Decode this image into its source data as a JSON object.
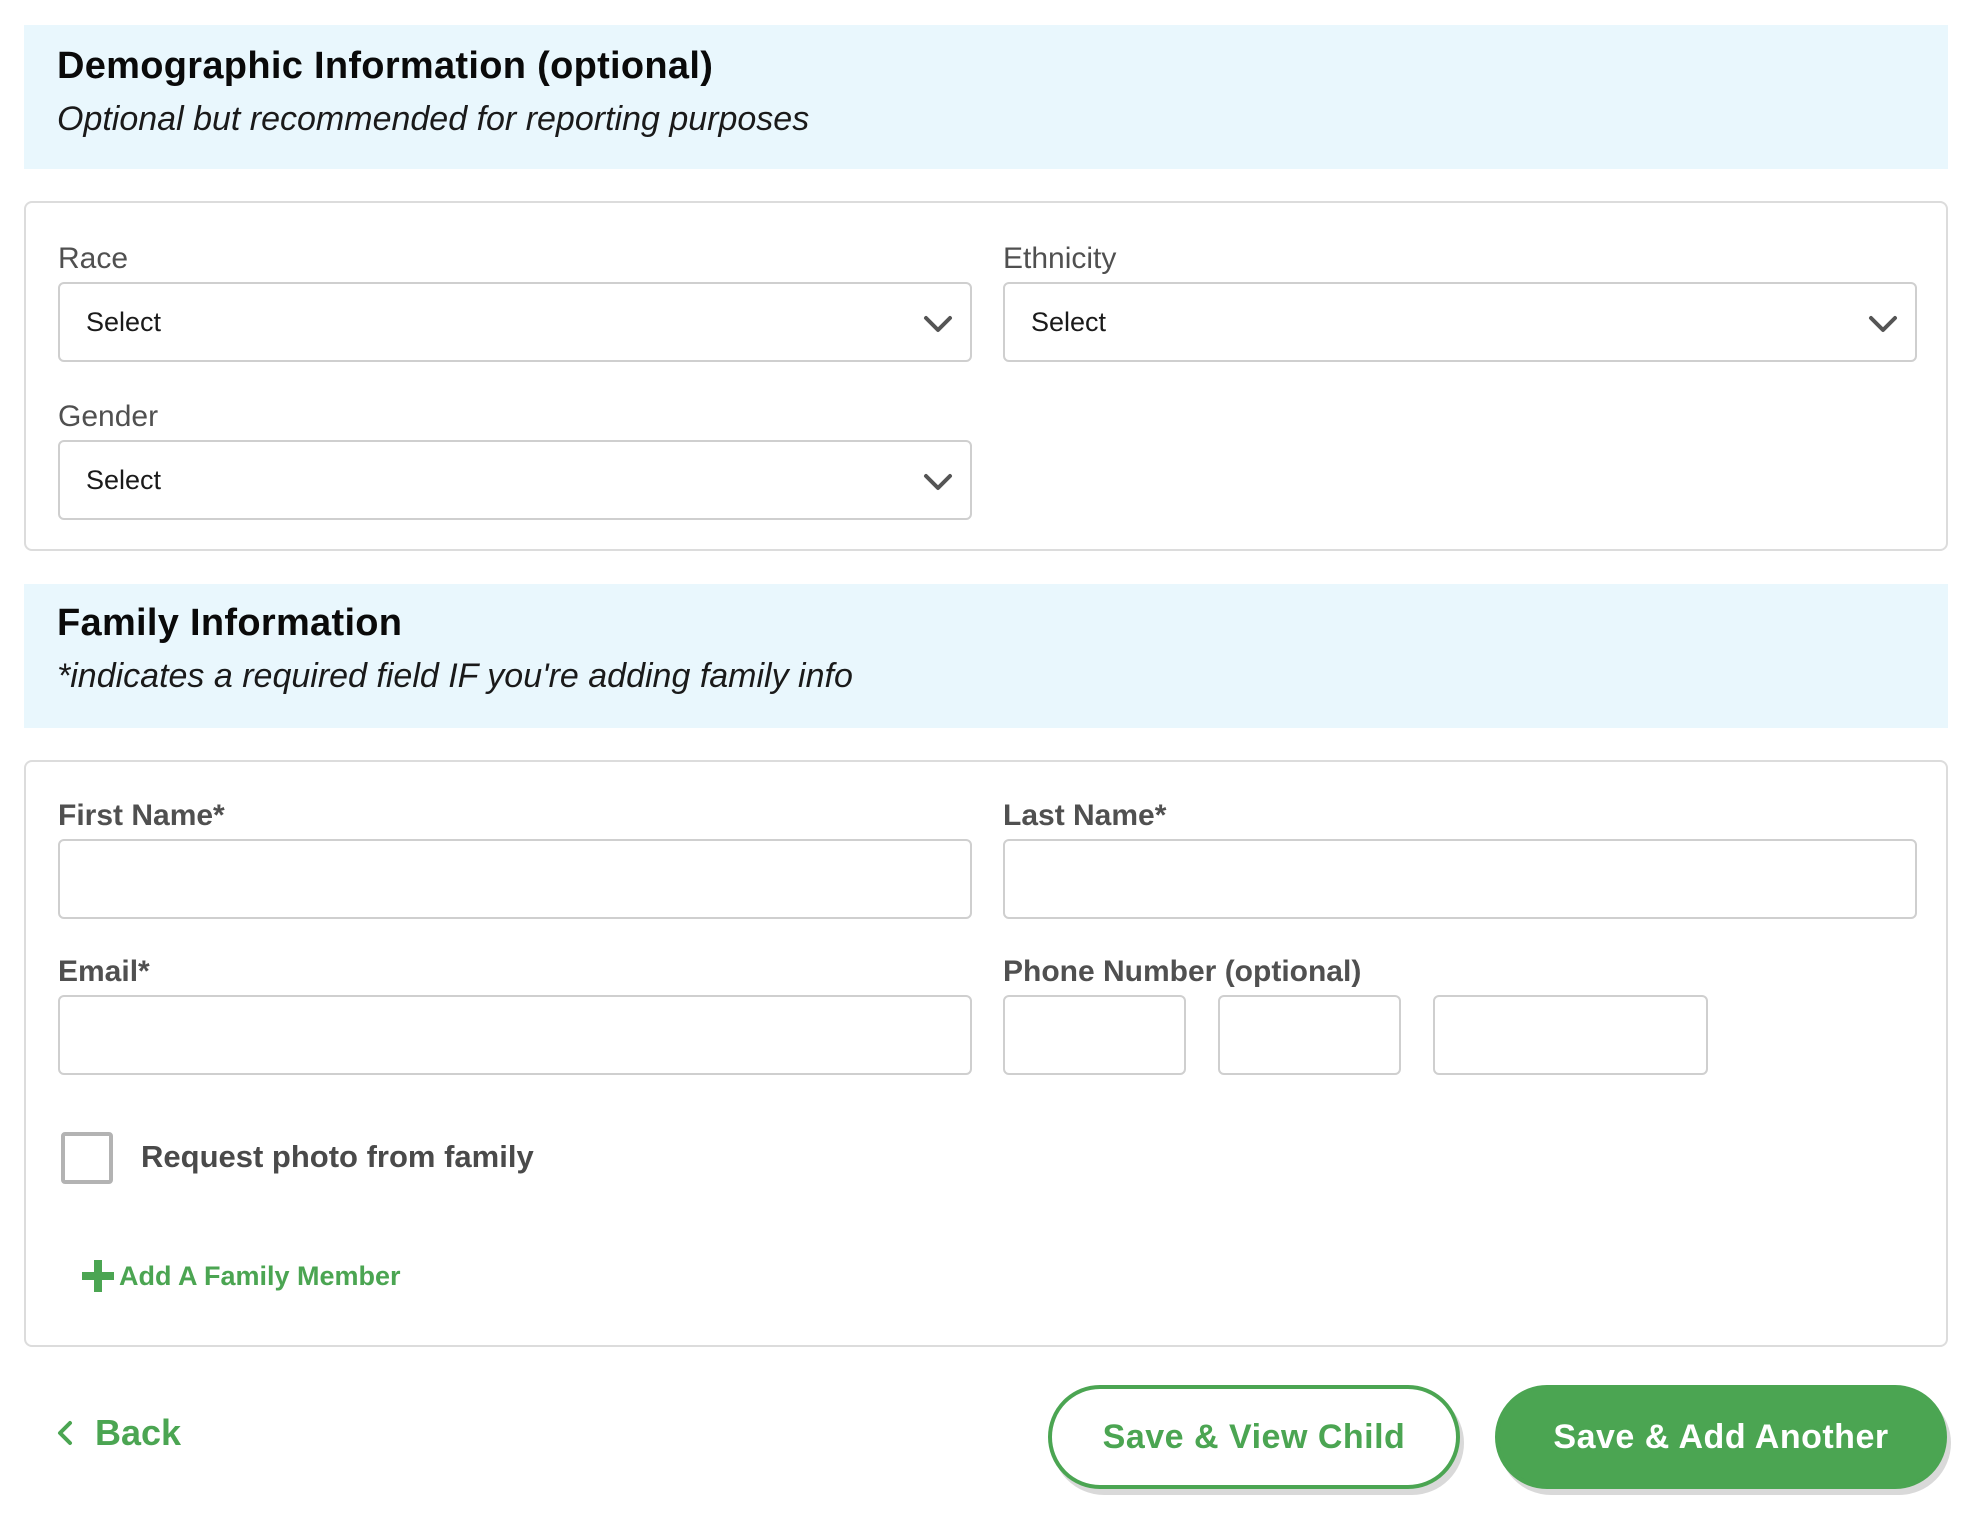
{
  "demographic": {
    "title": "Demographic Information (optional)",
    "subtitle": "Optional but recommended for reporting purposes",
    "race": {
      "label": "Race",
      "value": "Select"
    },
    "ethnicity": {
      "label": "Ethnicity",
      "value": "Select"
    },
    "gender": {
      "label": "Gender",
      "value": "Select"
    }
  },
  "family": {
    "title": "Family Information",
    "subtitle": "*indicates a required field IF you're adding family info",
    "first_name": {
      "label": "First Name*",
      "value": ""
    },
    "last_name": {
      "label": "Last Name*",
      "value": ""
    },
    "email": {
      "label": "Email*",
      "value": ""
    },
    "phone": {
      "label": "Phone Number (optional)",
      "area": "",
      "prefix": "",
      "line": ""
    },
    "request_photo": {
      "label": "Request photo from family",
      "checked": false
    },
    "add_member_label": "Add A Family Member"
  },
  "footer": {
    "back_label": "Back",
    "save_view_label": "Save & View Child",
    "save_add_label": "Save & Add Another"
  },
  "colors": {
    "accent_green": "#4ba552",
    "band_background": "#e9f7fd",
    "border_gray": "#cfcfcf"
  },
  "icons": {
    "select_chevron": "chevron-down-icon",
    "add": "plus-icon",
    "back": "chevron-left-icon"
  }
}
